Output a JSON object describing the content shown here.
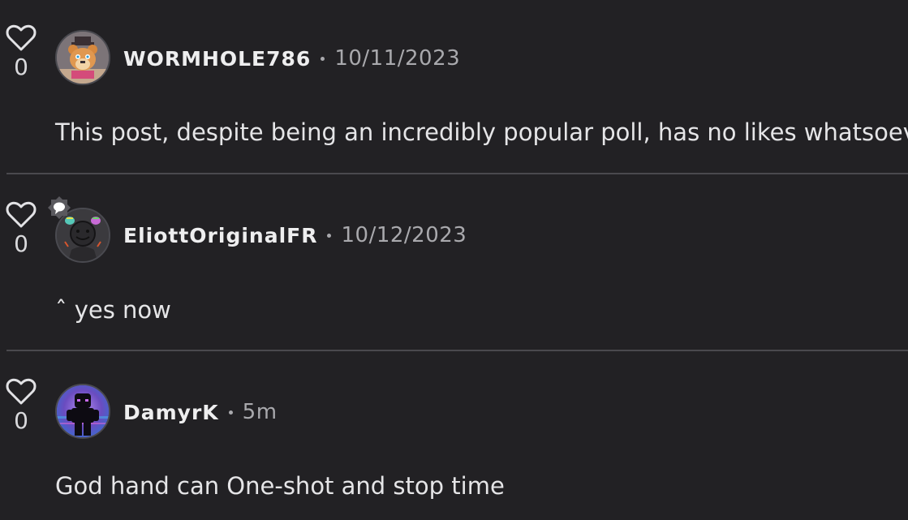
{
  "comments": [
    {
      "username": "WORMHOLE786",
      "date": "10/11/2023",
      "likes": "0",
      "text": "This post, despite being an incredibly popular poll, has no likes whatsoever.",
      "avatar_icon": "bear-mascot-avatar"
    },
    {
      "username": "EliottOriginalFR",
      "date": "10/12/2023",
      "likes": "0",
      "text": "ˆ yes now",
      "avatar_icon": "smiley-character-avatar",
      "badge_icon": "chat-bubble-badge-icon"
    },
    {
      "username": "DamyrK",
      "date": "5m",
      "likes": "0",
      "text": "God hand can One-shot and stop time",
      "avatar_icon": "dark-figure-avatar"
    }
  ],
  "colors": {
    "background": "#222124",
    "divider": "#4a494e",
    "muted_text": "#a9a9ad"
  }
}
